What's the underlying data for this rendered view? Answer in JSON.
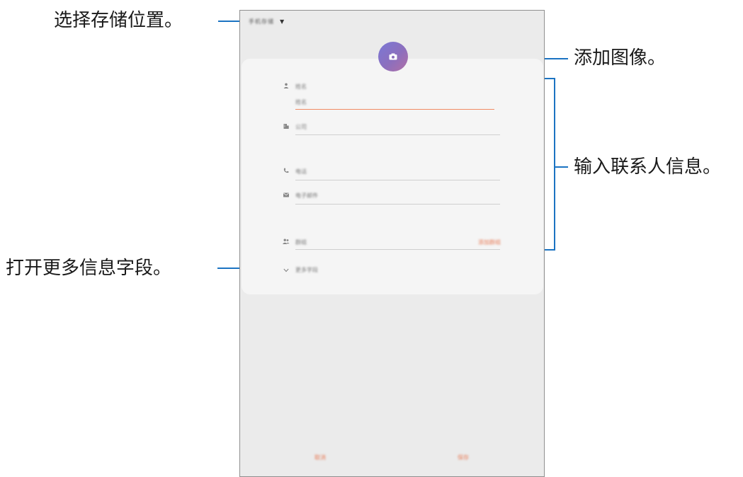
{
  "callouts": {
    "storage": "选择存储位置。",
    "image": "添加图像。",
    "contact_info": "输入联系人信息。",
    "more_fields": "打开更多信息字段。"
  },
  "form": {
    "storage_label": "手机存储",
    "name_label": "姓名",
    "name_placeholder": "姓名",
    "company_placeholder": "公司",
    "phone_placeholder": "电话",
    "email_placeholder": "电子邮件",
    "group_placeholder": "群组",
    "group_action": "添加群组",
    "more_label": "更多字段",
    "cancel_label": "取消",
    "save_label": "保存"
  },
  "icons": {
    "storage_dropdown": "caret-down-icon",
    "avatar": "camera-icon",
    "name": "person-icon",
    "company": "building-icon",
    "phone": "phone-icon",
    "email": "envelope-icon",
    "group": "group-icon",
    "more": "chevron-down-icon"
  },
  "colors": {
    "accent": "#f08a64",
    "callout_line": "#1b73c2",
    "avatar": "#8c6fbd"
  }
}
